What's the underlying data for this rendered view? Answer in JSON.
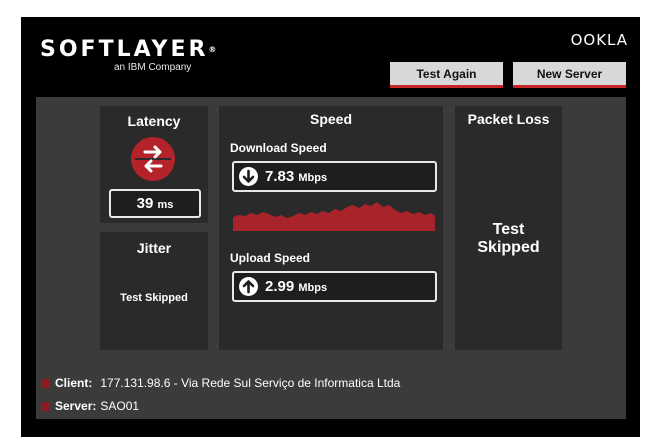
{
  "header": {
    "brand": "SOFTLAYER",
    "brand_reg": "®",
    "brand_sub": "an IBM Company",
    "provider": "OOKLA",
    "test_again_label": "Test Again",
    "new_server_label": "New Server"
  },
  "latency": {
    "title": "Latency",
    "value": "39",
    "unit": "ms"
  },
  "jitter": {
    "title": "Jitter",
    "status": "Test Skipped"
  },
  "speed": {
    "title": "Speed",
    "download_label": "Download Speed",
    "download_value": "7.83",
    "download_unit": "Mbps",
    "upload_label": "Upload Speed",
    "upload_value": "2.99",
    "upload_unit": "Mbps"
  },
  "packet_loss": {
    "title": "Packet Loss",
    "status_line1": "Test",
    "status_line2": "Skipped"
  },
  "footer": {
    "client_key": "Client:",
    "client_value": "177.131.98.6 - Via Rede Sul Serviço de Informatica Ltda",
    "server_key": "Server:",
    "server_value": "SAO01"
  },
  "colors": {
    "accent": "#c4272a",
    "panel": "#3b3b3b",
    "card": "#2a2a2a"
  }
}
